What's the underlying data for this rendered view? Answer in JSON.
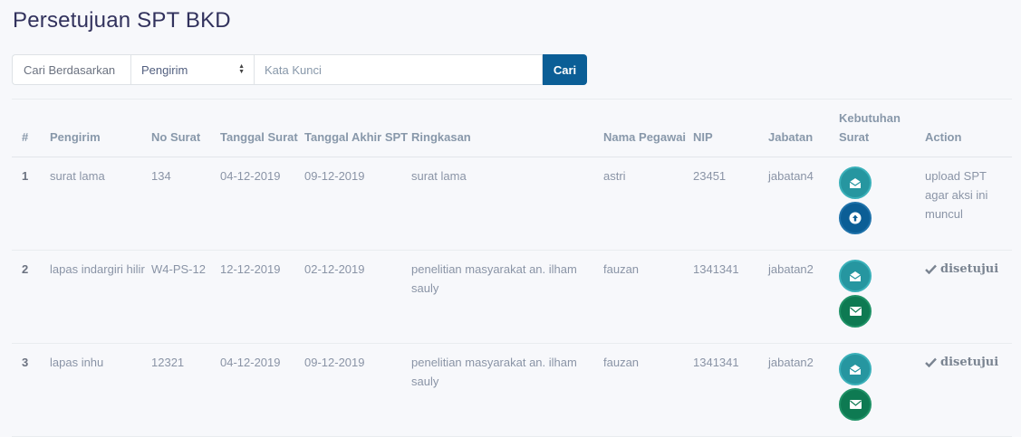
{
  "page": {
    "title": "Persetujuan SPT BKD"
  },
  "search": {
    "label": "Cari Berdasarkan",
    "select_value": "Pengirim",
    "placeholder": "Kata Kunci",
    "button_label": "Cari"
  },
  "table": {
    "headers": {
      "num": "#",
      "pengirim": "Pengirim",
      "no_surat": "No Surat",
      "tanggal_surat": "Tanggal Surat",
      "tanggal_akhir": "Tanggal Akhir SPT",
      "ringkasan": "Ringkasan",
      "nama_pegawai": "Nama Pegawai",
      "nip": "NIP",
      "jabatan": "Jabatan",
      "kebutuhan": "Kebutuhan Surat",
      "action": "Action"
    },
    "rows": [
      {
        "num": "1",
        "pengirim": "surat lama",
        "no_surat": "134",
        "tanggal_surat": "04-12-2019",
        "tanggal_akhir": "09-12-2019",
        "ringkasan": "surat lama",
        "nama_pegawai": "astri",
        "nip": "23451",
        "jabatan": "jabatan4",
        "action": "upload SPT agar aksi ini muncul"
      },
      {
        "num": "2",
        "pengirim": "lapas indargiri hilir",
        "no_surat": "W4-PS-12",
        "tanggal_surat": "12-12-2019",
        "tanggal_akhir": "02-12-2019",
        "ringkasan": "penelitian masyarakat an. ilham sauly",
        "nama_pegawai": "fauzan",
        "nip": "1341341",
        "jabatan": "jabatan2",
        "action": "disetujui"
      },
      {
        "num": "3",
        "pengirim": "lapas inhu",
        "no_surat": "12321",
        "tanggal_surat": "04-12-2019",
        "tanggal_akhir": "09-12-2019",
        "ringkasan": "penelitian masyarakat an. ilham sauly",
        "nama_pegawai": "fauzan",
        "nip": "1341341",
        "jabatan": "jabatan2",
        "action": "disetujui"
      }
    ]
  },
  "icons": {
    "open_envelope": "envelope-open-icon",
    "upload": "upload-icon",
    "closed_envelope": "envelope-icon",
    "check": "check-icon"
  },
  "colors": {
    "primary": "#0b5e96",
    "teal": "#2696a0",
    "green": "#0e7a52"
  }
}
